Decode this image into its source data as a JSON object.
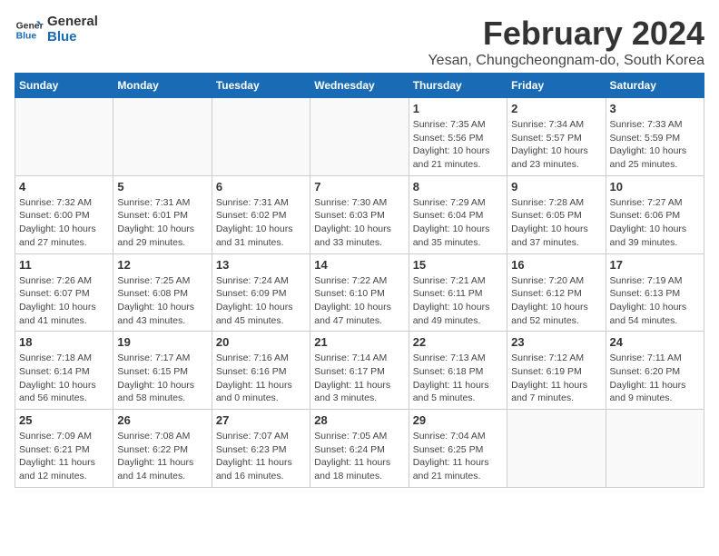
{
  "logo": {
    "line1": "General",
    "line2": "Blue"
  },
  "title": "February 2024",
  "location": "Yesan, Chungcheongnam-do, South Korea",
  "days_of_week": [
    "Sunday",
    "Monday",
    "Tuesday",
    "Wednesday",
    "Thursday",
    "Friday",
    "Saturday"
  ],
  "weeks": [
    [
      {
        "day": "",
        "detail": ""
      },
      {
        "day": "",
        "detail": ""
      },
      {
        "day": "",
        "detail": ""
      },
      {
        "day": "",
        "detail": ""
      },
      {
        "day": "1",
        "detail": "Sunrise: 7:35 AM\nSunset: 5:56 PM\nDaylight: 10 hours\nand 21 minutes."
      },
      {
        "day": "2",
        "detail": "Sunrise: 7:34 AM\nSunset: 5:57 PM\nDaylight: 10 hours\nand 23 minutes."
      },
      {
        "day": "3",
        "detail": "Sunrise: 7:33 AM\nSunset: 5:59 PM\nDaylight: 10 hours\nand 25 minutes."
      }
    ],
    [
      {
        "day": "4",
        "detail": "Sunrise: 7:32 AM\nSunset: 6:00 PM\nDaylight: 10 hours\nand 27 minutes."
      },
      {
        "day": "5",
        "detail": "Sunrise: 7:31 AM\nSunset: 6:01 PM\nDaylight: 10 hours\nand 29 minutes."
      },
      {
        "day": "6",
        "detail": "Sunrise: 7:31 AM\nSunset: 6:02 PM\nDaylight: 10 hours\nand 31 minutes."
      },
      {
        "day": "7",
        "detail": "Sunrise: 7:30 AM\nSunset: 6:03 PM\nDaylight: 10 hours\nand 33 minutes."
      },
      {
        "day": "8",
        "detail": "Sunrise: 7:29 AM\nSunset: 6:04 PM\nDaylight: 10 hours\nand 35 minutes."
      },
      {
        "day": "9",
        "detail": "Sunrise: 7:28 AM\nSunset: 6:05 PM\nDaylight: 10 hours\nand 37 minutes."
      },
      {
        "day": "10",
        "detail": "Sunrise: 7:27 AM\nSunset: 6:06 PM\nDaylight: 10 hours\nand 39 minutes."
      }
    ],
    [
      {
        "day": "11",
        "detail": "Sunrise: 7:26 AM\nSunset: 6:07 PM\nDaylight: 10 hours\nand 41 minutes."
      },
      {
        "day": "12",
        "detail": "Sunrise: 7:25 AM\nSunset: 6:08 PM\nDaylight: 10 hours\nand 43 minutes."
      },
      {
        "day": "13",
        "detail": "Sunrise: 7:24 AM\nSunset: 6:09 PM\nDaylight: 10 hours\nand 45 minutes."
      },
      {
        "day": "14",
        "detail": "Sunrise: 7:22 AM\nSunset: 6:10 PM\nDaylight: 10 hours\nand 47 minutes."
      },
      {
        "day": "15",
        "detail": "Sunrise: 7:21 AM\nSunset: 6:11 PM\nDaylight: 10 hours\nand 49 minutes."
      },
      {
        "day": "16",
        "detail": "Sunrise: 7:20 AM\nSunset: 6:12 PM\nDaylight: 10 hours\nand 52 minutes."
      },
      {
        "day": "17",
        "detail": "Sunrise: 7:19 AM\nSunset: 6:13 PM\nDaylight: 10 hours\nand 54 minutes."
      }
    ],
    [
      {
        "day": "18",
        "detail": "Sunrise: 7:18 AM\nSunset: 6:14 PM\nDaylight: 10 hours\nand 56 minutes."
      },
      {
        "day": "19",
        "detail": "Sunrise: 7:17 AM\nSunset: 6:15 PM\nDaylight: 10 hours\nand 58 minutes."
      },
      {
        "day": "20",
        "detail": "Sunrise: 7:16 AM\nSunset: 6:16 PM\nDaylight: 11 hours\nand 0 minutes."
      },
      {
        "day": "21",
        "detail": "Sunrise: 7:14 AM\nSunset: 6:17 PM\nDaylight: 11 hours\nand 3 minutes."
      },
      {
        "day": "22",
        "detail": "Sunrise: 7:13 AM\nSunset: 6:18 PM\nDaylight: 11 hours\nand 5 minutes."
      },
      {
        "day": "23",
        "detail": "Sunrise: 7:12 AM\nSunset: 6:19 PM\nDaylight: 11 hours\nand 7 minutes."
      },
      {
        "day": "24",
        "detail": "Sunrise: 7:11 AM\nSunset: 6:20 PM\nDaylight: 11 hours\nand 9 minutes."
      }
    ],
    [
      {
        "day": "25",
        "detail": "Sunrise: 7:09 AM\nSunset: 6:21 PM\nDaylight: 11 hours\nand 12 minutes."
      },
      {
        "day": "26",
        "detail": "Sunrise: 7:08 AM\nSunset: 6:22 PM\nDaylight: 11 hours\nand 14 minutes."
      },
      {
        "day": "27",
        "detail": "Sunrise: 7:07 AM\nSunset: 6:23 PM\nDaylight: 11 hours\nand 16 minutes."
      },
      {
        "day": "28",
        "detail": "Sunrise: 7:05 AM\nSunset: 6:24 PM\nDaylight: 11 hours\nand 18 minutes."
      },
      {
        "day": "29",
        "detail": "Sunrise: 7:04 AM\nSunset: 6:25 PM\nDaylight: 11 hours\nand 21 minutes."
      },
      {
        "day": "",
        "detail": ""
      },
      {
        "day": "",
        "detail": ""
      }
    ]
  ]
}
